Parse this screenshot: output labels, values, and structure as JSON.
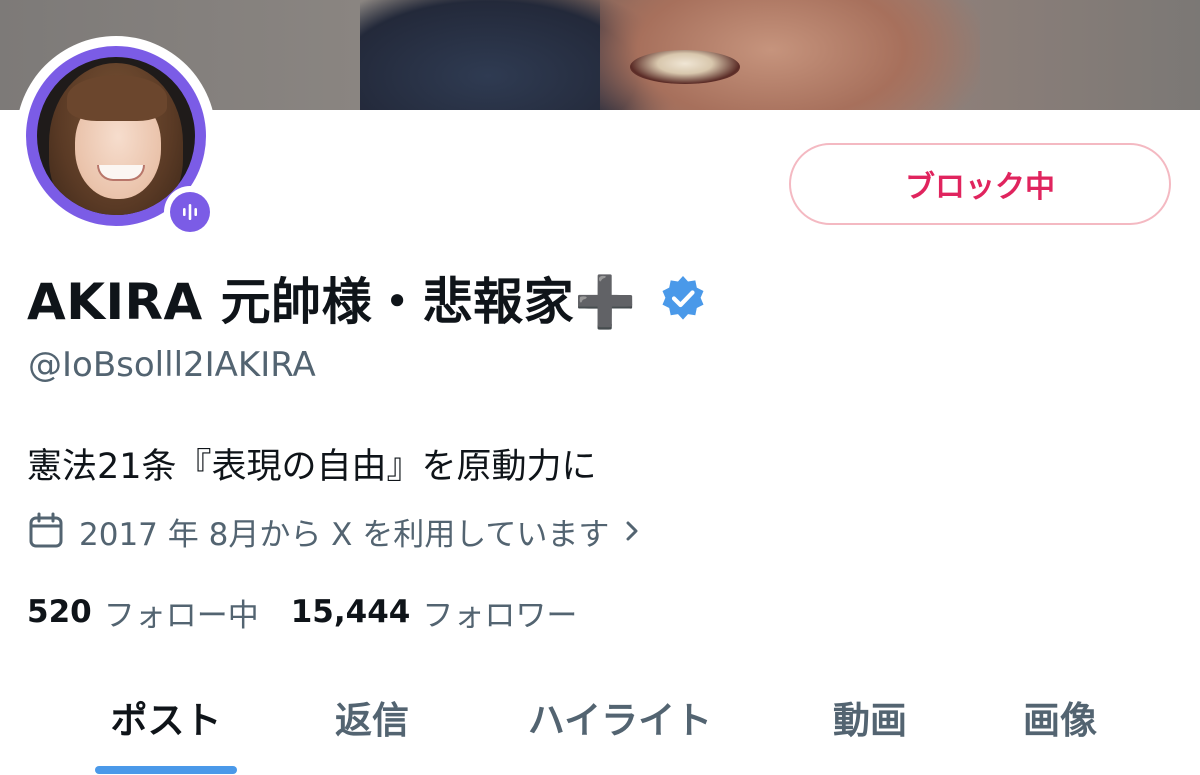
{
  "profile": {
    "display_name": "AKIRA 元帥様・悲報家➕",
    "handle": "@IoBsolll2IAKIRA",
    "bio": "憲法21条『表現の自由』を原動力に",
    "joined": "2017 年 8月から X を利用しています",
    "verified": true,
    "avatar_ring_color": "#7b5ce6",
    "verified_color": "#4a99e9"
  },
  "actions": {
    "block_label": "ブロック中",
    "block_color": "#e0245e"
  },
  "stats": {
    "following_count": "520",
    "following_label": "フォロー中",
    "followers_count": "15,444",
    "followers_label": "フォロワー"
  },
  "tabs": [
    {
      "label": "ポスト",
      "active": true
    },
    {
      "label": "返信",
      "active": false
    },
    {
      "label": "ハイライト",
      "active": false
    },
    {
      "label": "動画",
      "active": false
    },
    {
      "label": "画像",
      "active": false
    }
  ],
  "icons": {
    "verified": "verified-badge-icon",
    "calendar": "calendar-icon",
    "chevron": "chevron-right-icon",
    "mic": "microphone-icon"
  }
}
